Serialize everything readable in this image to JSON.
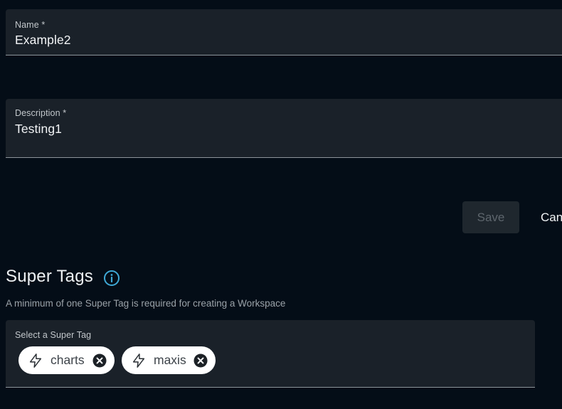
{
  "name_field": {
    "label": "Name *",
    "value": "Example2"
  },
  "description_field": {
    "label": "Description *",
    "value": "Testing1"
  },
  "actions": {
    "save_label": "Save",
    "cancel_label": "Cancel"
  },
  "super_tags": {
    "title": "Super Tags",
    "helper": "A minimum of one Super Tag is required for creating a Workspace",
    "select_label": "Select a Super Tag",
    "selected": [
      {
        "label": "charts",
        "icon": "bolt-icon"
      },
      {
        "label": "maxis",
        "icon": "bolt-icon"
      }
    ]
  },
  "colors": {
    "background": "#040d17",
    "field_background": "#1a2129",
    "info_icon": "#3fa9d6",
    "chip_background": "#ffffff"
  }
}
